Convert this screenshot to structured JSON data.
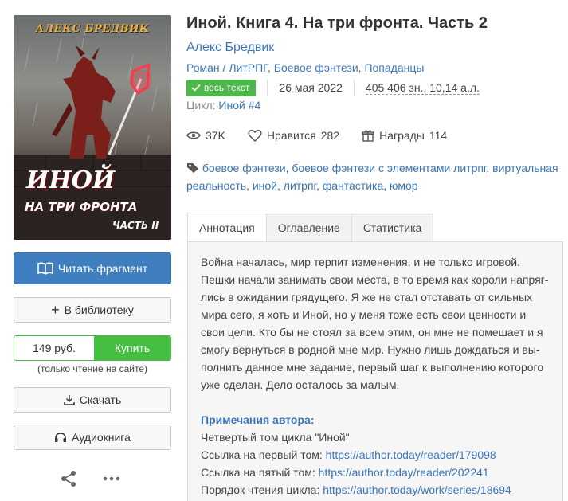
{
  "cover": {
    "author_text": "АЛЕКС БРЕДВИК",
    "title_line1": "ИНОЙ",
    "title_line2": "НА ТРИ ФРОНТА",
    "part_text": "ЧАСТЬ II"
  },
  "sidebar": {
    "read_label": "Читать фрагмент",
    "library_label": "В библиотеку",
    "price": "149 руб.",
    "buy_label": "Купить",
    "buy_note": "(только чтение на сайте)",
    "download_label": "Скачать",
    "audio_label": "Аудиокнига"
  },
  "book": {
    "title": "Иной. Книга 4. На три фронта. Часть 2",
    "author": "Алекс Бредвик",
    "genres": [
      "Роман / ЛитРПГ",
      "Боевое фэнтези",
      "Попаданцы"
    ],
    "status_badge": "весь текст",
    "date": "26 мая 2022",
    "size": "405 406 зн., 10,14 а.л.",
    "cycle_label": "Цикл:",
    "cycle_value": "Иной #4"
  },
  "stats": {
    "views": "37K",
    "likes_label": "Нравится",
    "likes": "282",
    "awards_label": "Награды",
    "awards": "114"
  },
  "tags": [
    "боевое фэнтези",
    "боевое фэнтези с элементами литрпг",
    "виртуальная реальность",
    "иной",
    "литрпг",
    "фантастика",
    "юмор"
  ],
  "tabs": [
    "Аннотация",
    "Оглавление",
    "Статистика"
  ],
  "annotation": {
    "text": "Война началась, мир терпит изменения, и не только игровой. Пешки начали занимать свои места, в то время как короли напряг­лись в ожидании грядущего. Я же не стал отставать от сильных мира сего, я хоть и Иной, но у меня тоже есть свои ценности и свои цели. Кто бы не стоял за всем этим, он мне не помешает и я смогу вернуться в родной мне мир. Нужно лишь дождаться и вы­полнить данное мне задание, первый шаг к выполнению которого уже сделан. Дело осталось за малым.",
    "notes_title": "Примечания автора:",
    "note1": "Четвертый том цикла \"Иной\"",
    "note2_label": "Ссылка на первый том:",
    "note2_link": "https://author.today/reader/179098",
    "note3_label": "Ссылка на пятый том:",
    "note3_link": "https://author.today/reader/202241",
    "note4_label": "Порядок чтения цикла:",
    "note4_link": "https://author.today/work/series/18694"
  },
  "colors": {
    "accent_blue": "#3f7fbf",
    "link_blue": "#3a76b7",
    "buy_green": "#45bf41"
  }
}
